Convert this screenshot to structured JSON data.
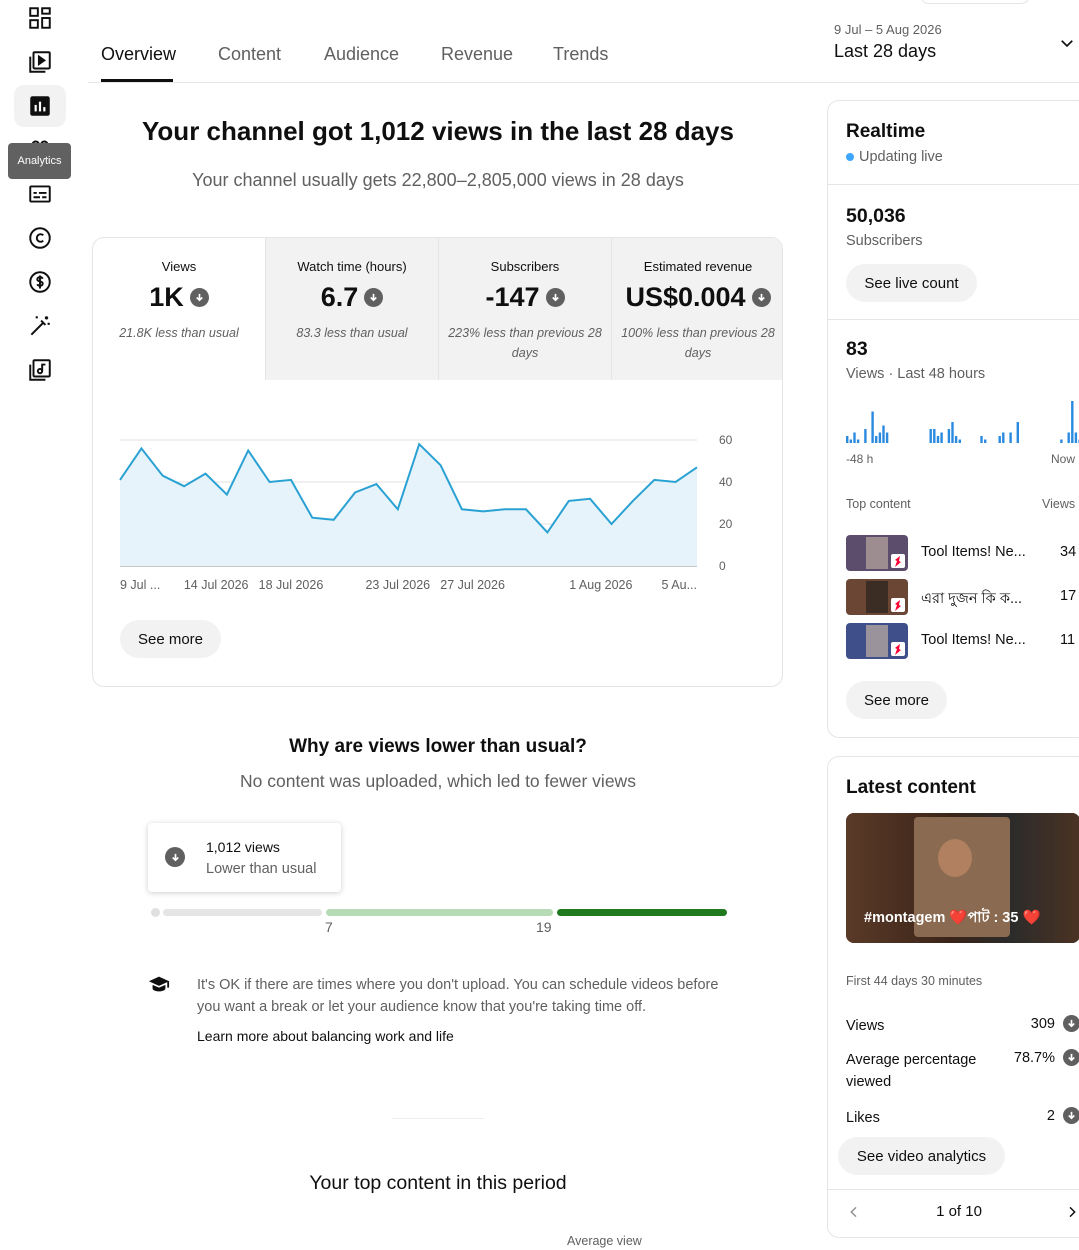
{
  "sidebar": {
    "tooltip": "Analytics",
    "icons": [
      "dashboard-icon",
      "content-icon",
      "analytics-icon",
      "community-icon",
      "subtitles-icon",
      "copyright-icon",
      "earn-icon",
      "customization-icon",
      "audio-library-icon"
    ]
  },
  "tabs": [
    "Overview",
    "Content",
    "Audience",
    "Revenue",
    "Trends"
  ],
  "date_range": {
    "range": "9 Jul – 5 Aug 2026",
    "label": "Last 28 days"
  },
  "headline": "Your channel got 1,012 views in the last 28 days",
  "subhead": "Your channel usually gets 22,800–2,805,000 views in 28 days",
  "metrics": [
    {
      "label": "Views",
      "value": "1K",
      "note": "21.8K less than usual"
    },
    {
      "label": "Watch time (hours)",
      "value": "6.7",
      "note": "83.3 less than usual"
    },
    {
      "label": "Subscribers",
      "value": "-147",
      "note": "223% less than previous 28 days"
    },
    {
      "label": "Estimated revenue",
      "value": "US$0.004",
      "note": "100% less than previous 28 days"
    }
  ],
  "chart_data": {
    "type": "area",
    "x": [
      "9 Jul 2026",
      "10 Jul 2026",
      "11 Jul 2026",
      "12 Jul 2026",
      "13 Jul 2026",
      "14 Jul 2026",
      "15 Jul 2026",
      "16 Jul 2026",
      "17 Jul 2026",
      "18 Jul 2026",
      "19 Jul 2026",
      "20 Jul 2026",
      "21 Jul 2026",
      "22 Jul 2026",
      "23 Jul 2026",
      "24 Jul 2026",
      "25 Jul 2026",
      "26 Jul 2026",
      "27 Jul 2026",
      "28 Jul 2026",
      "29 Jul 2026",
      "30 Jul 2026",
      "31 Jul 2026",
      "1 Aug 2026",
      "2 Aug 2026",
      "3 Aug 2026",
      "4 Aug 2026",
      "5 Aug 2026"
    ],
    "values": [
      41,
      56,
      43,
      38,
      44,
      34,
      55,
      40,
      41,
      23,
      22,
      35,
      39,
      27,
      58,
      48,
      27,
      26,
      27,
      27,
      16,
      31,
      32,
      20,
      31,
      41,
      40,
      47
    ],
    "ylim": [
      0,
      60
    ],
    "yticks": [
      "60",
      "40",
      "20",
      "0"
    ],
    "xticks": [
      "9 Jul ...",
      "14 Jul 2026",
      "18 Jul 2026",
      "23 Jul 2026",
      "27 Jul 2026",
      "1 Aug 2026",
      "5 Au..."
    ],
    "grid": true,
    "color": "#2aa1d3"
  },
  "see_more": "See more",
  "why": {
    "title": "Why are views lower than usual?",
    "subtitle": "No content was uploaded, which led to fewer views",
    "pop_value": "1,012 views",
    "pop_label": "Lower than usual",
    "marker_low": "7",
    "marker_high": "19",
    "tip": "It's OK if there are times where you don't upload. You can schedule videos before you want a break or let your audience know that you're taking time off.",
    "link": "Learn more about balancing work and life"
  },
  "top_content_title": "Your top content in this period",
  "average_view": "Average view",
  "realtime": {
    "title": "Realtime",
    "live": "Updating live",
    "subscribers_value": "50,036",
    "subscribers_label": "Subscribers",
    "live_count_button": "See live count",
    "views_value": "83",
    "views_label": "Views · Last 48 hours",
    "axis_start": "-48 h",
    "axis_end": "Now",
    "top_content_label": "Top content",
    "views_col_label": "Views",
    "hourly_views": [
      2,
      1,
      3,
      1,
      0,
      4,
      0,
      9,
      2,
      3,
      5,
      3,
      0,
      0,
      0,
      0,
      0,
      0,
      0,
      0,
      0,
      0,
      0,
      4,
      4,
      2,
      3,
      0,
      4,
      6,
      2,
      1,
      0,
      0,
      0,
      0,
      0,
      2,
      1,
      0,
      0,
      0,
      2,
      3,
      0,
      3,
      0,
      6,
      0,
      0,
      0,
      0,
      0,
      0,
      0,
      0,
      0,
      0,
      0,
      1,
      0,
      3,
      12,
      3,
      1
    ],
    "items": [
      {
        "title": "Tool Items! Ne...",
        "views": "34",
        "color": "#5b4d6b"
      },
      {
        "title": "এরা দুজন কি ক...",
        "views": "17",
        "color": "#6b4634"
      },
      {
        "title": "Tool Items! Ne...",
        "views": "11",
        "color": "#3f4f8a"
      }
    ],
    "see_more": "See more"
  },
  "latest": {
    "title": "Latest content",
    "caption": "#montagem ❤️পাট : 35 ❤️",
    "first": "First 44 days 30 minutes",
    "rows": [
      {
        "label": "Views",
        "value": "309"
      },
      {
        "label": "Average percentage viewed",
        "value": "78.7%"
      },
      {
        "label": "Likes",
        "value": "2"
      }
    ],
    "button": "See video analytics",
    "pager": "1 of 10"
  }
}
